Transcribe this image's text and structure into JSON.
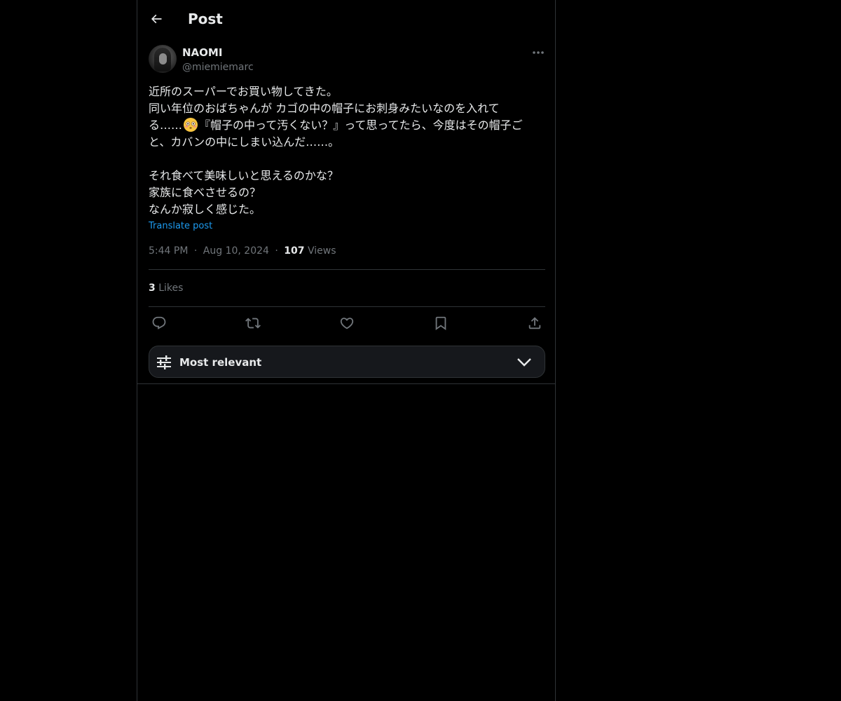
{
  "header": {
    "title": "Post",
    "back_icon": "arrow-left-icon"
  },
  "author": {
    "display_name": "NAOMI",
    "handle": "@miemiemarc"
  },
  "post": {
    "line1": "近所のスーパーでお買い物してきた。",
    "line2": "同い年位のおばちゃんが カゴの中の帽子にお刺身みたいなのを入れて",
    "line3_before_emoji": "る……",
    "emoji": "flushed-face-emoji",
    "line3_after_emoji": "『帽子の中って汚くない？』って思ってたら、今度はその帽子ご",
    "line4": "と、カバンの中にしまい込んだ……。",
    "line5": "それ食べて美味しいと思えるのかな？",
    "line6": "家族に食べさせるの？",
    "line7": "なんか寂しく感じた。",
    "translate_label": "Translate post",
    "time": "5:44 PM",
    "date": "Aug 10, 2024",
    "separator": "·",
    "views_count": "107",
    "views_label": "Views",
    "likes_count": "3",
    "likes_label": "Likes"
  },
  "actions": {
    "reply_icon": "reply-icon",
    "repost_icon": "repost-icon",
    "like_icon": "heart-icon",
    "bookmark_icon": "bookmark-icon",
    "share_icon": "share-icon"
  },
  "sort": {
    "label": "Most relevant",
    "icon": "sliders-icon",
    "chevron": "chevron-down-icon"
  },
  "colors": {
    "background": "#000000",
    "text": "#e7e9ea",
    "muted": "#71767b",
    "link": "#1d9bf0",
    "border": "#2f3336"
  }
}
